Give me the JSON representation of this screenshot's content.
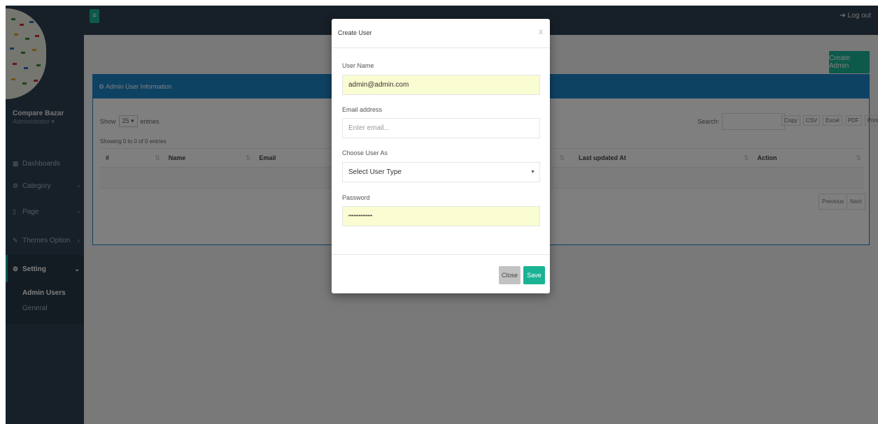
{
  "sidebar": {
    "profile_name": "Compare Bazar",
    "profile_role": "Administrator ▾",
    "items": [
      {
        "icon": "▦",
        "label": "Dashboards",
        "chevron": ""
      },
      {
        "icon": "⚙",
        "label": "Category",
        "chevron": "‹"
      },
      {
        "icon": "▯",
        "label": "Page",
        "chevron": "‹"
      },
      {
        "icon": "✎",
        "label": "Themes Option",
        "chevron": "‹"
      },
      {
        "icon": "⚙",
        "label": "Setting",
        "chevron": "⌄"
      }
    ],
    "sub_items": [
      "Admin Users",
      "General"
    ]
  },
  "topbar": {
    "menu_glyph": "≡",
    "logout_label": "➜ Log out"
  },
  "page": {
    "create_admin_label": "Create Admin",
    "panel_title": "⚙ Admin User Information",
    "show_label": "Show",
    "entries_value": "25 ▾",
    "entries_label": "entries",
    "search_label": "Search:",
    "export_buttons": [
      "Copy",
      "CSV",
      "Excel",
      "PDF",
      "Print"
    ],
    "showing_text": "Showing 0 to 0 of 0 entries",
    "columns": [
      "#",
      "Name",
      "Email",
      "",
      "Last updated At",
      "Action"
    ],
    "pager": [
      "Previous",
      "Next"
    ]
  },
  "modal": {
    "title": "Create User",
    "close_glyph": "x",
    "fields": {
      "username_label": "User Name",
      "username_value": "admin@admin.com",
      "email_label": "Email address",
      "email_placeholder": "Enter email...",
      "usertype_label": "Choose User As",
      "usertype_value": "Select User Type",
      "password_label": "Password",
      "password_value": "••••••••••••••"
    },
    "close_label": "Close",
    "save_label": "Save"
  },
  "colors": {
    "sidebar": "#2f4050",
    "accent": "#1ab394",
    "panel_blue": "#1c84c6",
    "autofill": "#fafcd1"
  }
}
